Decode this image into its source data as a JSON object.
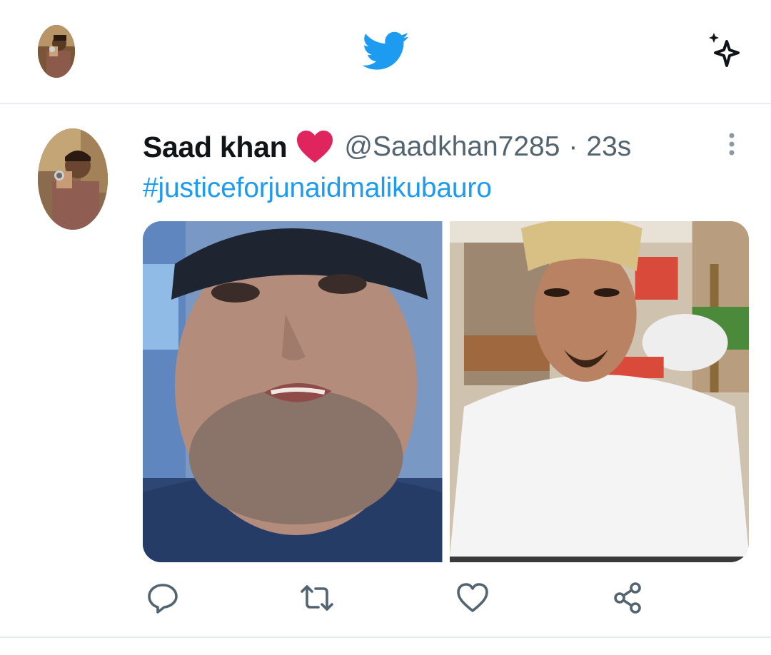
{
  "header": {
    "logo_icon": "twitter-bird-icon",
    "sparkle_icon": "sparkle-icon",
    "brand_color": "#1d9bf0"
  },
  "tweet": {
    "display_name": "Saad khan",
    "name_emoji": "red-heart",
    "handle": "@Saadkhan7285",
    "separator": "·",
    "time": "23s",
    "text": "#justiceforjunaidmalikubauro",
    "photos": [
      {
        "name": "photo-crying-man"
      },
      {
        "name": "photo-young-man-cap"
      }
    ],
    "actions": [
      {
        "icon": "reply-icon"
      },
      {
        "icon": "retweet-icon"
      },
      {
        "icon": "like-icon"
      },
      {
        "icon": "share-icon"
      }
    ],
    "colors": {
      "text": "#0f1419",
      "secondary": "#536471",
      "link": "#1d9bf0",
      "heart": "#e0245e"
    }
  }
}
